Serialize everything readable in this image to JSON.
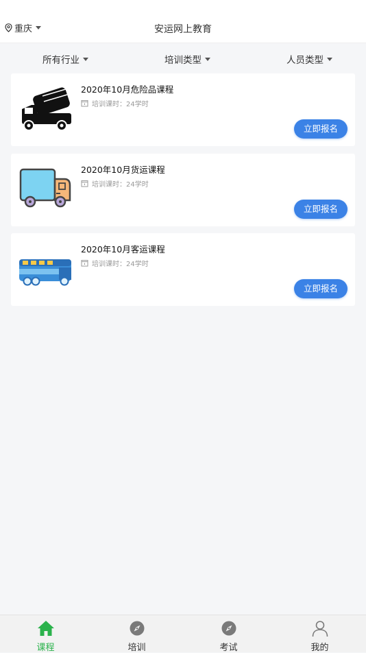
{
  "header": {
    "location": "重庆",
    "title": "安运网上教育"
  },
  "filters": [
    {
      "label": "所有行业"
    },
    {
      "label": "培训类型"
    },
    {
      "label": "人员类型"
    }
  ],
  "courses": [
    {
      "title": "2020年10月危险品课程",
      "hours": "培训课时：24学时",
      "button": "立即报名",
      "icon": "mixer-truck-icon"
    },
    {
      "title": "2020年10月货运课程",
      "hours": "培训课时：24学时",
      "button": "立即报名",
      "icon": "cargo-truck-icon"
    },
    {
      "title": "2020年10月客运课程",
      "hours": "培训课时：24学时",
      "button": "立即报名",
      "icon": "bus-icon"
    }
  ],
  "tabs": [
    {
      "label": "课程",
      "icon": "home-icon",
      "active": true
    },
    {
      "label": "培训",
      "icon": "compass-icon",
      "active": false
    },
    {
      "label": "考试",
      "icon": "compass-icon",
      "active": false
    },
    {
      "label": "我的",
      "icon": "user-icon",
      "active": false
    }
  ],
  "colors": {
    "accent": "#3b82e6",
    "active_tab": "#2bb24c",
    "background": "#f5f6f8"
  }
}
